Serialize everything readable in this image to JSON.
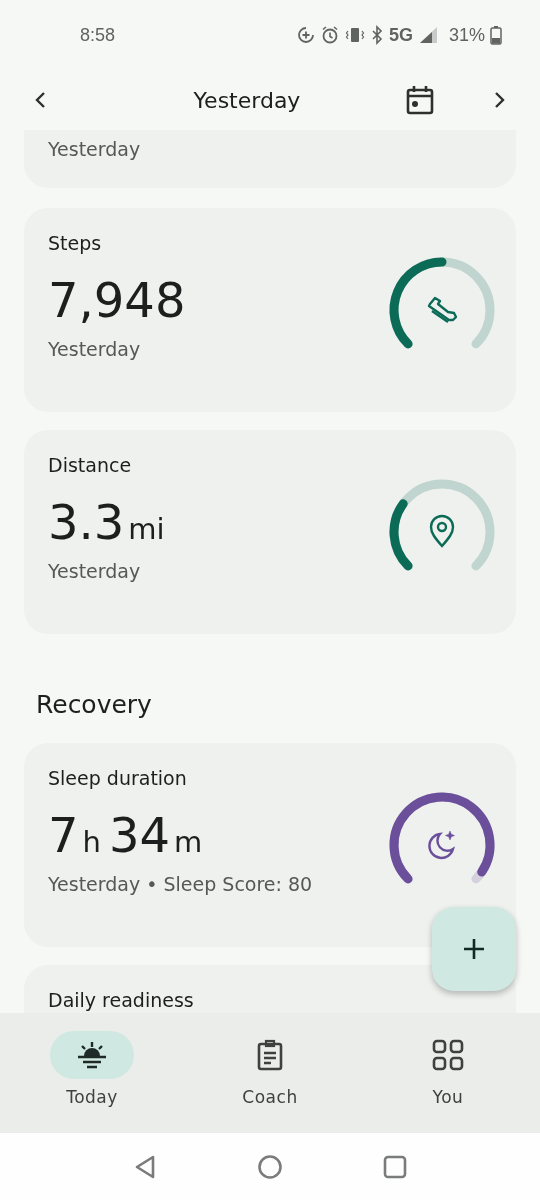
{
  "status_bar": {
    "time": "8:58",
    "network": "5G",
    "battery": "31%"
  },
  "header": {
    "title": "Yesterday"
  },
  "partial_card": {
    "subtitle": "Yesterday"
  },
  "activity": [
    {
      "title": "Steps",
      "value": [
        {
          "text": "7,948",
          "kind": "number"
        }
      ],
      "subtitle": "Yesterday",
      "gauge": {
        "color": "#0b6b57"
      }
    },
    {
      "title": "Distance",
      "value": [
        {
          "text": "3.3",
          "kind": "number"
        },
        {
          "text": "mi",
          "kind": "unit"
        }
      ],
      "subtitle": "Yesterday",
      "gauge": {
        "color": "#0b6b57"
      }
    }
  ],
  "recovery": {
    "heading": "Recovery",
    "cards": [
      {
        "title": "Sleep duration",
        "value": [
          {
            "text": "7",
            "kind": "number"
          },
          {
            "text": "h",
            "kind": "unit"
          },
          {
            "text": "34",
            "kind": "number"
          },
          {
            "text": "m",
            "kind": "unit"
          }
        ],
        "subtitle": "Yesterday • Sleep Score: 80",
        "gauge": {
          "color": "#6b4f9a"
        }
      },
      {
        "title": "Daily readiness"
      }
    ]
  },
  "nav": [
    {
      "label": "Today",
      "selected": true
    },
    {
      "label": "Coach",
      "selected": false
    },
    {
      "label": "You",
      "selected": false
    }
  ]
}
